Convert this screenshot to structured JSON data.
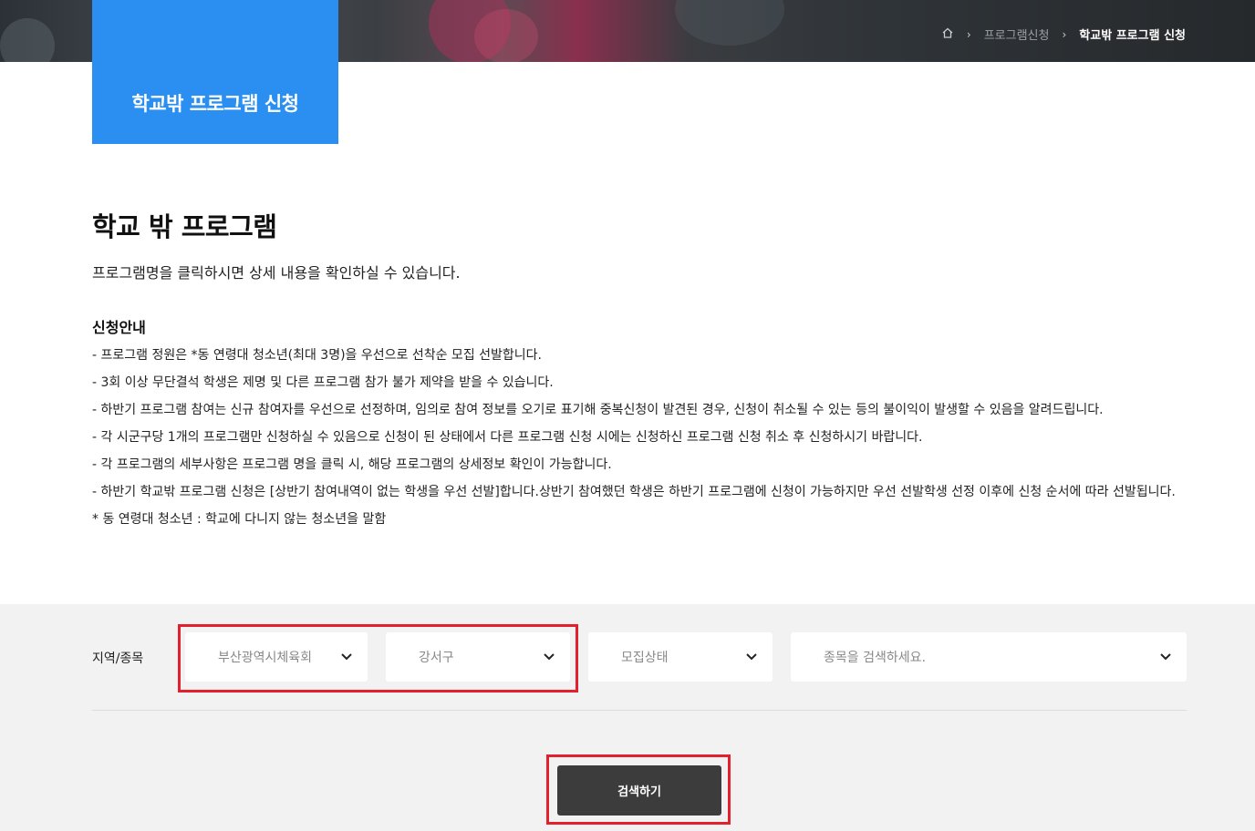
{
  "breadcrumb": {
    "home_icon": "home-icon",
    "items": [
      "프로그램신청",
      "학교밖 프로그램 신청"
    ]
  },
  "header": {
    "title": "학교밖 프로그램 신청"
  },
  "main": {
    "heading": "학교 밖 프로그램",
    "intro": "프로그램명을 클릭하시면 상세 내용을 확인하실 수 있습니다.",
    "notice_title": "신청안내",
    "notices": [
      "- 프로그램 정원은 *동 연령대 청소년(최대 3명)을 우선으로 선착순 모집 선발합니다.",
      "- 3회 이상 무단결석 학생은 제명 및 다른 프로그램 참가 불가 제약을 받을 수 있습니다.",
      "- 하반기 프로그램 참여는 신규 참여자를 우선으로 선정하며, 임의로 참여 정보를 오기로 표기해 중복신청이 발견된 경우, 신청이 취소될 수 있는 등의 불이익이 발생할 수 있음을 알려드립니다.",
      "- 각 시군구당 1개의 프로그램만 신청하실 수 있음으로 신청이 된 상태에서 다른 프로그램 신청 시에는 신청하신 프로그램 신청 취소 후 신청하시기 바랍니다.",
      "- 각 프로그램의 세부사항은 프로그램 명을 클릭 시, 해당 프로그램의 상세정보 확인이 가능합니다.",
      "- 하반기 학교밖 프로그램 신청은 [상반기 참여내역이 없는 학생을 우선 선발]합니다.상반기 참여했던 학생은 하반기 프로그램에 신청이 가능하지만 우선 선발학생 선정 이후에 신청 순서에 따라 선발됩니다.",
      "* 동 연령대 청소년 : 학교에 다니지 않는 청소년을 말함"
    ]
  },
  "search": {
    "label": "지역/종목",
    "selects": [
      {
        "value": "부산광역시체육회"
      },
      {
        "value": "강서구"
      },
      {
        "value": "모집상태"
      },
      {
        "value": "종목을 검색하세요."
      }
    ],
    "button_label": "검색하기"
  },
  "colors": {
    "accent": "#2a8ff0",
    "highlight": "#e3202e",
    "button": "#3c3c3c"
  }
}
